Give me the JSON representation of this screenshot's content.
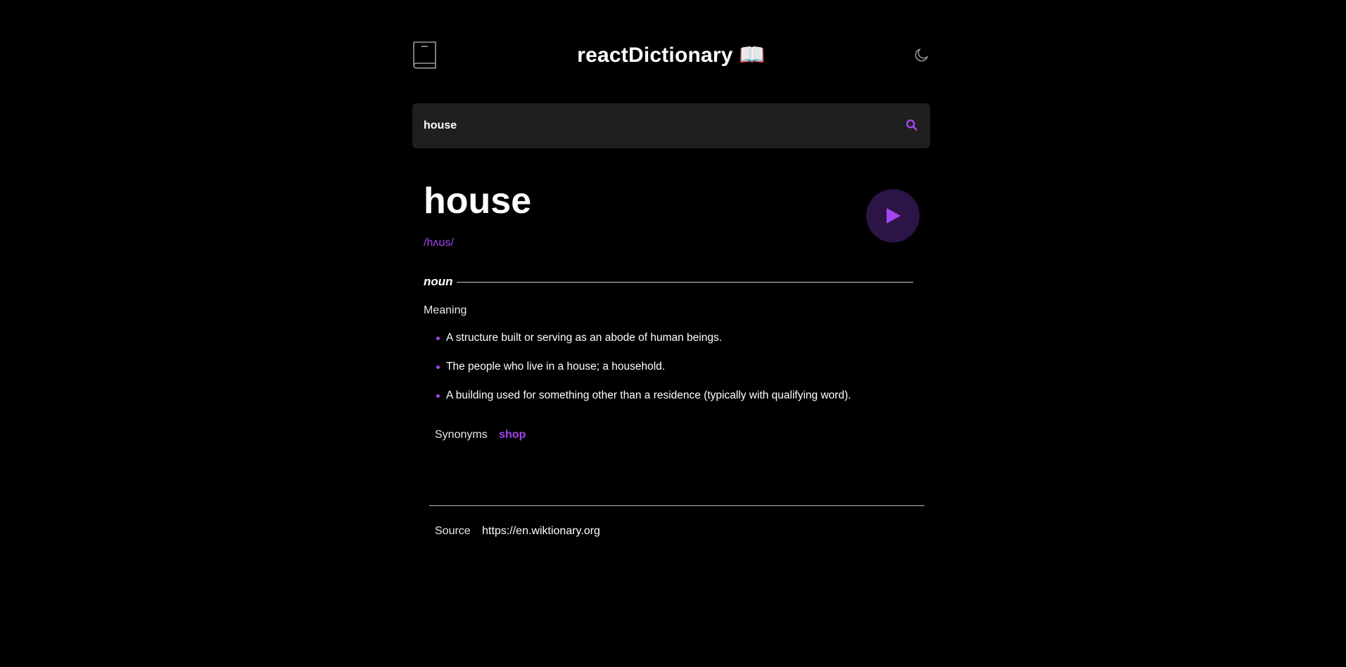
{
  "header": {
    "title": "reactDictionary 📖",
    "logo_icon": "book-icon",
    "theme_icon": "moon-icon"
  },
  "search": {
    "value": "house",
    "placeholder": "",
    "icon": "search-icon"
  },
  "entry": {
    "word": "house",
    "phonetic": "/hʌʊs/",
    "play_icon": "play-icon",
    "part_of_speech": "noun",
    "meaning_heading": "Meaning",
    "definitions": [
      "A structure built or serving as an abode of human beings.",
      "The people who live in a house; a household.",
      "A building used for something other than a residence (typically with qualifying word)."
    ],
    "synonyms_label": "Synonyms",
    "synonyms": [
      "shop"
    ]
  },
  "footer": {
    "source_label": "Source",
    "source_url": "https://en.wiktionary.org"
  },
  "colors": {
    "accent": "#a445ed",
    "background": "#000000",
    "search_bg": "#1f1f1f",
    "play_bg": "#2c1446"
  }
}
